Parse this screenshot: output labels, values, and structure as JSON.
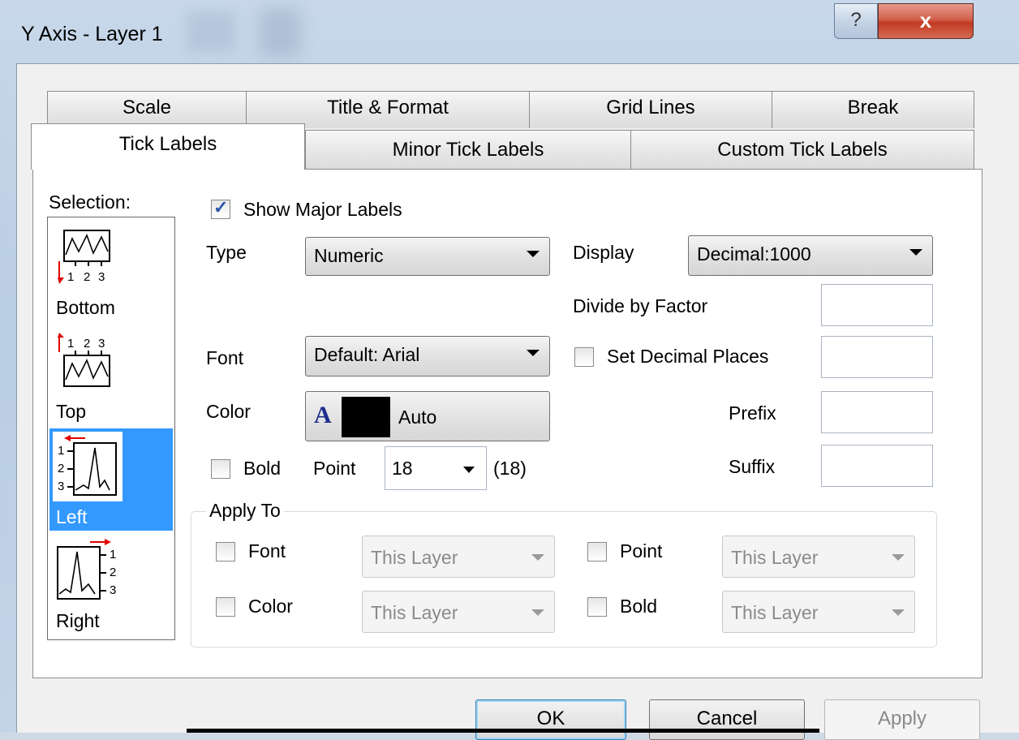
{
  "window": {
    "title": "Y Axis - Layer 1",
    "help_glyph": "?",
    "close_glyph": "x"
  },
  "tabs_row1": [
    {
      "label": "Scale"
    },
    {
      "label": "Title & Format"
    },
    {
      "label": "Grid Lines"
    },
    {
      "label": "Break"
    }
  ],
  "tabs_row2": [
    {
      "label": "Tick Labels",
      "active": true
    },
    {
      "label": "Minor Tick Labels"
    },
    {
      "label": "Custom Tick Labels"
    }
  ],
  "selection": {
    "label": "Selection:",
    "items": [
      {
        "label": "Bottom",
        "icon": "bottom-axis-icon"
      },
      {
        "label": "Top",
        "icon": "top-axis-icon"
      },
      {
        "label": "Left",
        "icon": "left-axis-icon",
        "selected": true
      },
      {
        "label": "Right",
        "icon": "right-axis-icon"
      }
    ]
  },
  "show_major_labels": {
    "label": "Show Major Labels",
    "checked": true
  },
  "type": {
    "label": "Type",
    "value": "Numeric"
  },
  "display": {
    "label": "Display",
    "value": "Decimal:1000"
  },
  "divide_by_factor": {
    "label": "Divide by Factor",
    "value": ""
  },
  "font": {
    "label": "Font",
    "value": "Default: Arial"
  },
  "set_decimal_places": {
    "label": "Set Decimal Places",
    "checked": false,
    "value": ""
  },
  "color": {
    "label": "Color",
    "glyph": "A",
    "value": "Auto",
    "swatch": "#000000"
  },
  "prefix": {
    "label": "Prefix",
    "value": ""
  },
  "suffix": {
    "label": "Suffix",
    "value": ""
  },
  "bold": {
    "label": "Bold",
    "checked": false
  },
  "point": {
    "label": "Point",
    "value": "18",
    "hint": "(18)"
  },
  "apply_to": {
    "title": "Apply To",
    "rows": [
      {
        "label": "Font",
        "value": "This Layer"
      },
      {
        "label": "Point",
        "value": "This Layer"
      },
      {
        "label": "Color",
        "value": "This Layer"
      },
      {
        "label": "Bold",
        "value": "This Layer"
      }
    ]
  },
  "buttons": {
    "ok": "OK",
    "cancel": "Cancel",
    "apply": "Apply"
  },
  "colors": {
    "selection_highlight": "#3399ff",
    "tick_marker": "#e00000",
    "checkbox_tick": "#2b55a8"
  }
}
